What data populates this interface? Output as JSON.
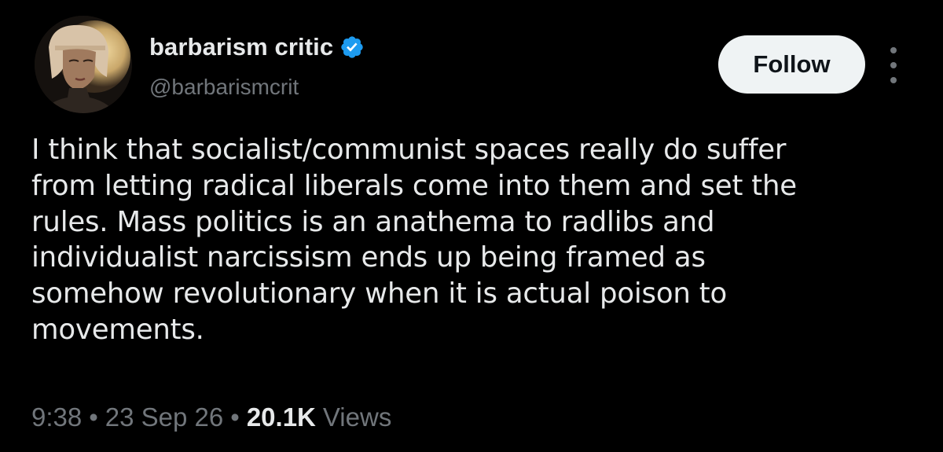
{
  "author": {
    "display_name": "barbarism critic",
    "handle": "@barbarismcrit",
    "verified": true,
    "avatar_icon": "avatar-portrait"
  },
  "actions": {
    "follow_label": "Follow",
    "more_icon": "more-vertical-icon"
  },
  "tweet": {
    "text": "I think that socialist/communist spaces really do suffer\nfrom letting radical liberals come into them and set the\nrules. Mass politics is an anathema to radlibs and\nindividualist narcissism ends up being framed as\nsomehow revolutionary when it is actual poison to\nmovements."
  },
  "meta": {
    "time": "9:38",
    "separator": "•",
    "date": "23 Sep 26",
    "views_count": "20.1K",
    "views_label": "Views"
  },
  "colors": {
    "background": "#000000",
    "primary_text": "#e7e9ea",
    "secondary_text": "#71767b",
    "verified_badge": "#1d9bf0",
    "follow_button_bg": "#eff3f4",
    "follow_button_text": "#0f1419"
  }
}
